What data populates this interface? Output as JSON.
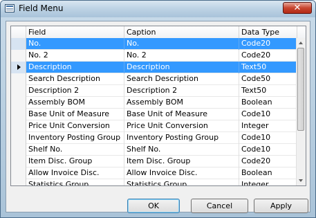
{
  "window": {
    "title": "Field Menu",
    "close_label": "✕"
  },
  "grid": {
    "columns": [
      "Field",
      "Caption",
      "Data Type"
    ],
    "rows": [
      {
        "field": "No.",
        "caption": "No.",
        "type": "Code20"
      },
      {
        "field": "No. 2",
        "caption": "No. 2",
        "type": "Code20"
      },
      {
        "field": "Description",
        "caption": "Description",
        "type": "Text50"
      },
      {
        "field": "Search Description",
        "caption": "Search Description",
        "type": "Code50"
      },
      {
        "field": "Description 2",
        "caption": "Description 2",
        "type": "Text50"
      },
      {
        "field": "Assembly BOM",
        "caption": "Assembly BOM",
        "type": "Boolean"
      },
      {
        "field": "Base Unit of Measure",
        "caption": "Base Unit of Measure",
        "type": "Code10"
      },
      {
        "field": "Price Unit Conversion",
        "caption": "Price Unit Conversion",
        "type": "Integer"
      },
      {
        "field": "Inventory Posting Group",
        "caption": "Inventory Posting Group",
        "type": "Code10"
      },
      {
        "field": "Shelf No.",
        "caption": "Shelf No.",
        "type": "Code10"
      },
      {
        "field": "Item Disc. Group",
        "caption": "Item Disc. Group",
        "type": "Code20"
      },
      {
        "field": "Allow Invoice Disc.",
        "caption": "Allow Invoice Disc.",
        "type": "Boolean"
      },
      {
        "field": "Statistics Group",
        "caption": "Statistics Group",
        "type": "Integer"
      }
    ]
  },
  "buttons": {
    "ok": "OK",
    "cancel": "Cancel",
    "apply": "Apply"
  }
}
